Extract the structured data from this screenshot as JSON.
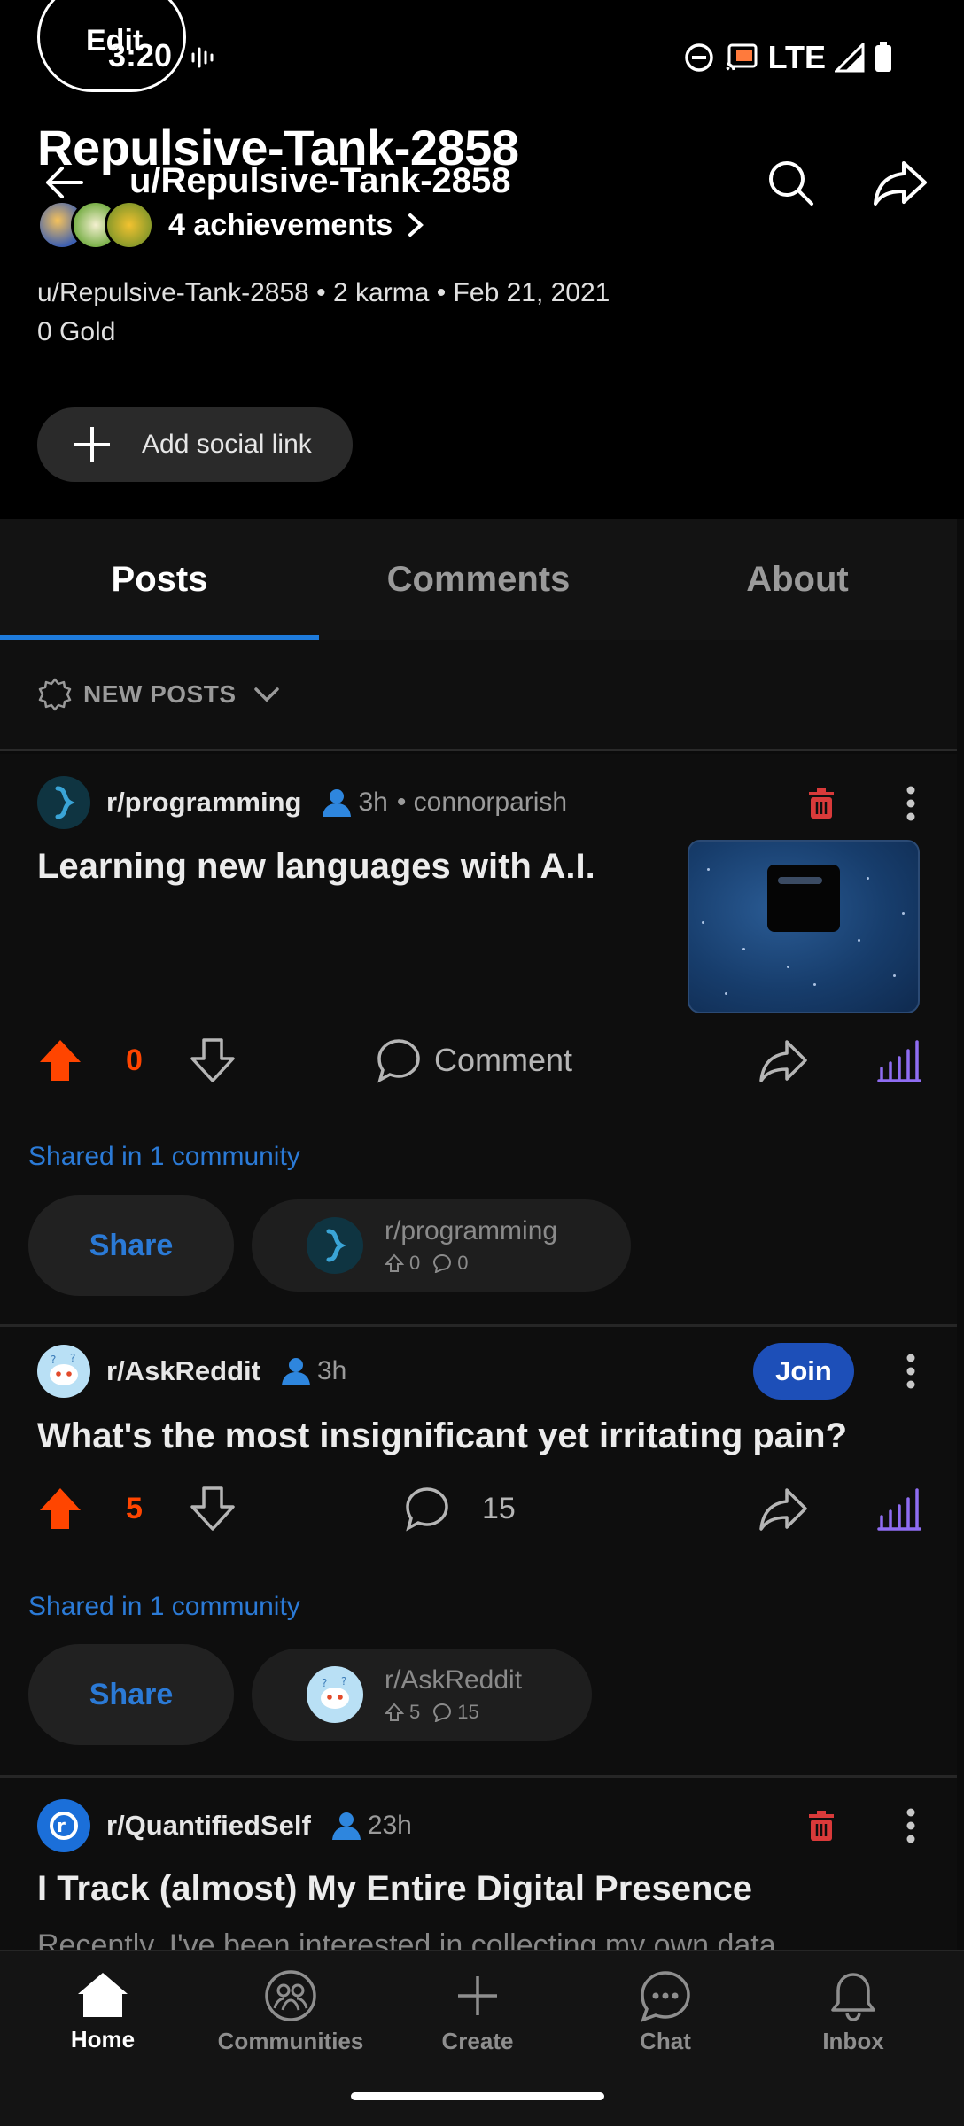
{
  "status_bar": {
    "time": "3:20",
    "network": "LTE"
  },
  "edit_overlay": {
    "label": "Edit"
  },
  "header": {
    "big_title": "Repulsive-Tank-2858",
    "small_title": "u/Repulsive-Tank-2858",
    "achievements_label": "4 achievements",
    "meta": "u/Repulsive-Tank-2858 • 2 karma • Feb 21, 2021",
    "gold": "0 Gold",
    "social_button": "Add social link"
  },
  "tabs": [
    {
      "label": "Posts",
      "active": true
    },
    {
      "label": "Comments",
      "active": false
    },
    {
      "label": "About",
      "active": false
    }
  ],
  "sort": {
    "label": "NEW POSTS"
  },
  "posts": [
    {
      "subreddit": "r/programming",
      "time": "3h",
      "author": "• connorparish",
      "title": "Learning new languages with A.I.",
      "votes": "0",
      "comment_label": "Comment",
      "shared_in": "Shared in 1 community",
      "share_label": "Share",
      "community": {
        "name": "r/programming",
        "votes": "0",
        "comments": "0"
      }
    },
    {
      "subreddit": "r/AskReddit",
      "time": "3h",
      "join_label": "Join",
      "title": "What's the most insignificant yet irritating pain?",
      "votes": "5",
      "comments": "15",
      "shared_in": "Shared in 1 community",
      "share_label": "Share",
      "community": {
        "name": "r/AskReddit",
        "votes": "5",
        "comments": "15"
      }
    },
    {
      "subreddit": "r/QuantifiedSelf",
      "time": "23h",
      "title": "I Track (almost) My Entire Digital Presence",
      "body": "Recently, I've been interested in collecting my own data"
    }
  ],
  "bottom_nav": [
    {
      "label": "Home",
      "icon": "home-icon",
      "active": true
    },
    {
      "label": "Communities",
      "icon": "communities-icon",
      "active": false
    },
    {
      "label": "Create",
      "icon": "plus-icon",
      "active": false
    },
    {
      "label": "Chat",
      "icon": "chat-icon",
      "active": false
    },
    {
      "label": "Inbox",
      "icon": "bell-icon",
      "active": false
    }
  ],
  "colors": {
    "upvote": "#ff4500",
    "link_blue": "#2b7ad6",
    "tab_indicator": "#1e7bdc",
    "join_blue": "#1d4fb8",
    "delete_red": "#d93a3a"
  }
}
